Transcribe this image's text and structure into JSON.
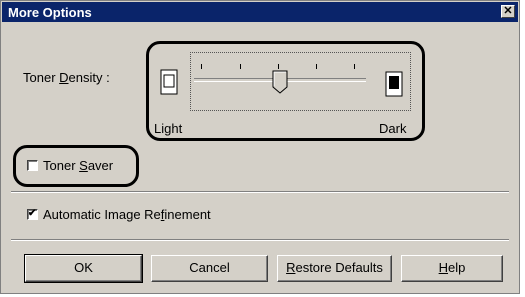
{
  "window": {
    "title": "More Options",
    "close_glyph": "✕"
  },
  "toner_density": {
    "label_before": "Toner ",
    "label_accel": "D",
    "label_after": "ensity :",
    "min_label": "Light",
    "max_label": "Dark",
    "level": 0.5
  },
  "toner_saver": {
    "label_before": "Toner ",
    "label_accel": "S",
    "label_after": "aver",
    "checked": false
  },
  "auto_refinement": {
    "label_before": "Automatic Image Re",
    "label_accel": "f",
    "label_after": "inement",
    "checked": true,
    "check_glyph": "✔"
  },
  "buttons": {
    "ok": "OK",
    "cancel": "Cancel",
    "restore_accel": "R",
    "restore_rest": "estore Defaults",
    "help_accel": "H",
    "help_rest": "elp"
  }
}
